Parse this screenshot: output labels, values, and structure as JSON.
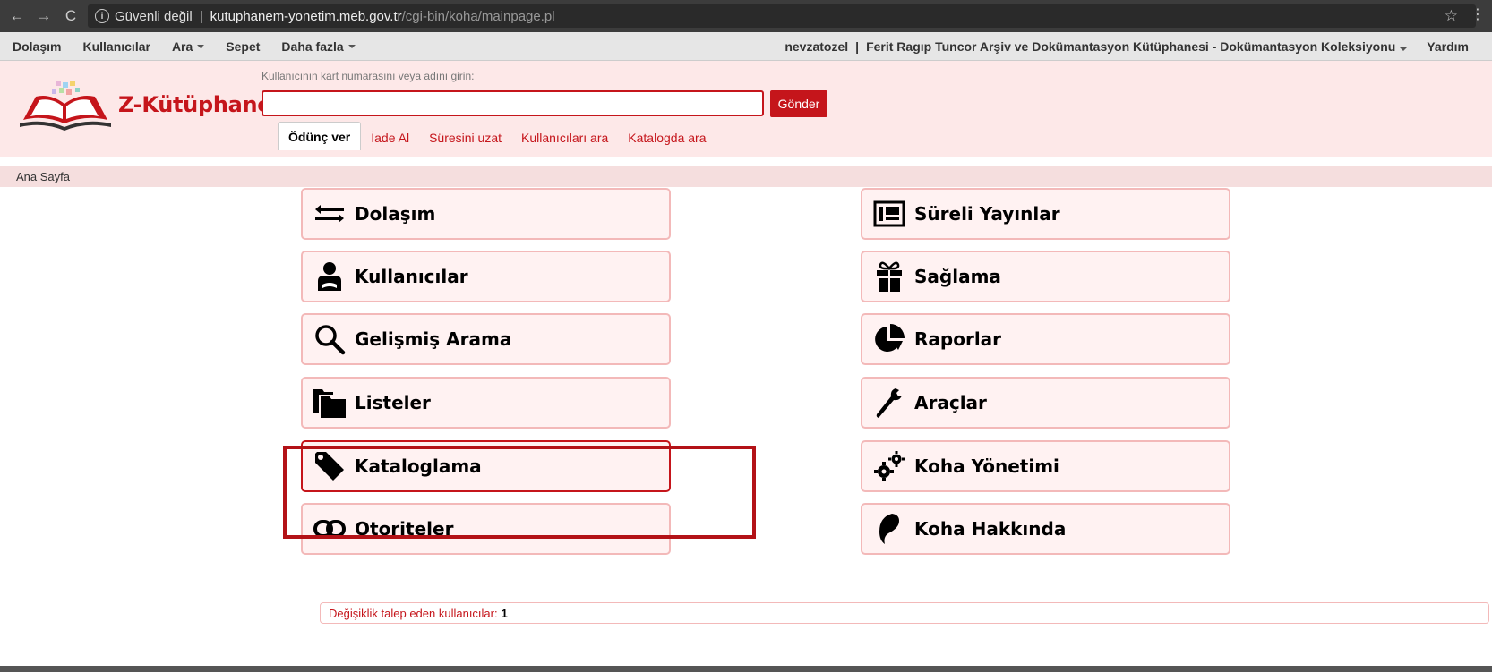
{
  "browser": {
    "security_label": "Güvenli değil",
    "url_host": "kutuphanem-yonetim.meb.gov.tr",
    "url_path": "/cgi-bin/koha/mainpage.pl"
  },
  "topnav": {
    "items": [
      {
        "label": "Dolaşım",
        "dropdown": false
      },
      {
        "label": "Kullanıcılar",
        "dropdown": false
      },
      {
        "label": "Ara",
        "dropdown": true
      },
      {
        "label": "Sepet",
        "dropdown": false
      },
      {
        "label": "Daha fazla",
        "dropdown": true
      }
    ],
    "user": "nevzatozel",
    "library": "Ferit Ragıp Tuncor Arşiv ve Dokümantasyon Kütüphanesi - Dokümantasyon Koleksiyonu",
    "help": "Yardım"
  },
  "header": {
    "logo_text": "Z-Kütüphane",
    "search_label": "Kullanıcının kart numarasını veya adını girin:",
    "search_value": "",
    "submit": "Gönder",
    "tabs": [
      "Ödünç ver",
      "İade Al",
      "Süresini uzat",
      "Kullanıcıları ara",
      "Katalogda ara"
    ],
    "active_tab": 0
  },
  "breadcrumb": "Ana Sayfa",
  "modules_left": [
    {
      "label": "Dolaşım",
      "icon": "exchange-arrows-icon"
    },
    {
      "label": "Kullanıcılar",
      "icon": "user-icon"
    },
    {
      "label": "Gelişmiş Arama",
      "icon": "search-icon"
    },
    {
      "label": "Listeler",
      "icon": "folders-icon"
    },
    {
      "label": "Kataloglama",
      "icon": "tag-icon"
    },
    {
      "label": "Otoriteler",
      "icon": "link-icon"
    }
  ],
  "modules_right": [
    {
      "label": "Süreli Yayınlar",
      "icon": "newspaper-icon"
    },
    {
      "label": "Sağlama",
      "icon": "gift-icon"
    },
    {
      "label": "Raporlar",
      "icon": "pie-chart-icon"
    },
    {
      "label": "Araçlar",
      "icon": "wrench-icon"
    },
    {
      "label": "Koha Yönetimi",
      "icon": "gears-icon"
    },
    {
      "label": "Koha Hakkında",
      "icon": "koha-leaf-icon"
    }
  ],
  "highlighted_module": "Kataloglama",
  "pending_modifications": {
    "label": "Değişiklik talep eden kullanıcılar:",
    "count": "1"
  },
  "colors": {
    "accent": "#c5151b",
    "module_bg": "#fff2f2",
    "module_border": "#f3b9b9",
    "highlight_frame": "#b31217"
  }
}
